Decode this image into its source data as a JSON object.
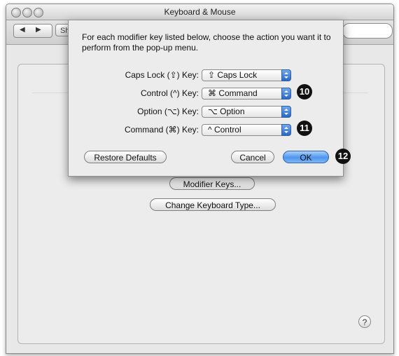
{
  "window": {
    "title": "Keyboard & Mouse",
    "toolbar": {
      "back_icon": "triangle-left",
      "forward_icon": "triangle-right",
      "show_all_label": "Show All"
    }
  },
  "pane": {
    "buttons": {
      "modifier_keys": "Modifier Keys...",
      "change_keyboard_type": "Change Keyboard Type..."
    },
    "help_label": "?"
  },
  "sheet": {
    "message": "For each modifier key listed below, choose the action you want it to perform from the pop-up menu.",
    "rows": [
      {
        "label": "Caps Lock (⇪) Key:",
        "value": "⇪ Caps Lock"
      },
      {
        "label": "Control (^) Key:",
        "value": "⌘ Command"
      },
      {
        "label": "Option (⌥) Key:",
        "value": "⌥ Option"
      },
      {
        "label": "Command (⌘) Key:",
        "value": "^ Control"
      }
    ],
    "buttons": {
      "restore": "Restore Defaults",
      "cancel": "Cancel",
      "ok": "OK"
    }
  },
  "callouts": [
    "10",
    "11",
    "12"
  ],
  "colors": {
    "ok_button": "#4f95ee",
    "popup_arrows": "#2a68c9",
    "callout": "#111111"
  }
}
